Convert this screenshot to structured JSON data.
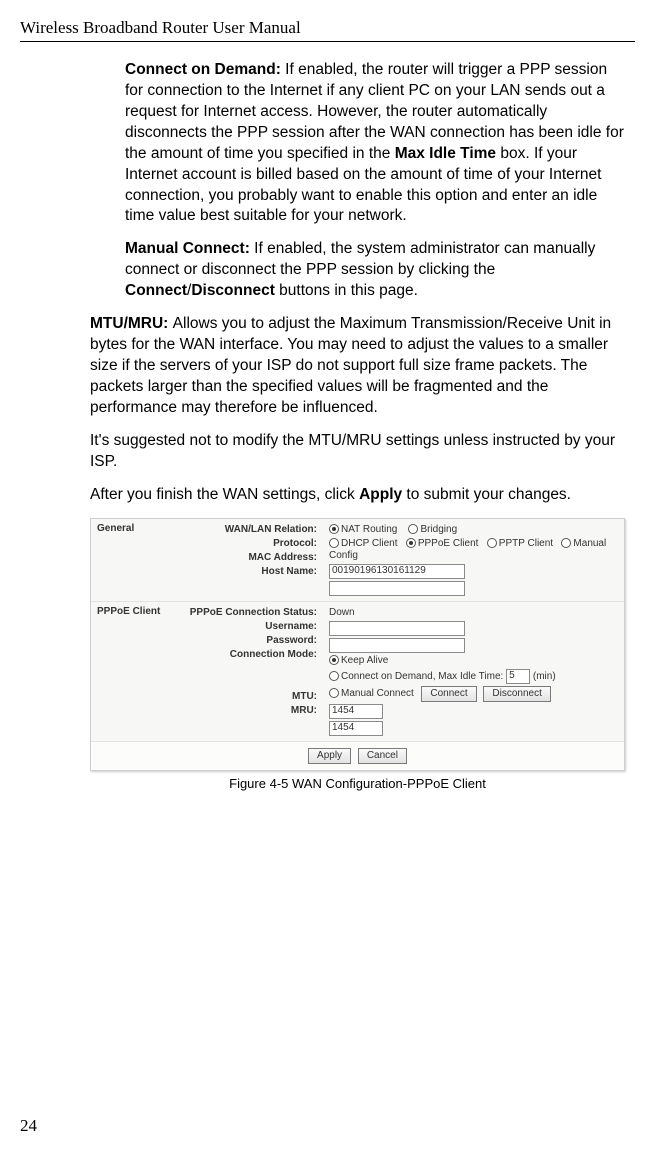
{
  "header": {
    "running_head": "Wireless Broadband Router User Manual"
  },
  "prose": {
    "para1": {
      "lead": "Connect on Demand: ",
      "text_a": "If enabled, the router will trigger a PPP session for connection to the Internet if any client PC on your LAN sends out a request for Internet access. However, the router automatically disconnects the PPP session after the WAN connection has been idle for the amount of time you specified in the ",
      "bold_mid": "Max Idle Time",
      "text_b": " box. If your Internet account is billed based on the amount of time of your Internet connection, you probably want to enable this option and enter an idle time value best suitable for your network."
    },
    "para2": {
      "lead": "Manual Connect: ",
      "text_a": "If enabled, the system administrator can manually connect or disconnect the PPP session by clicking the ",
      "bold_mid": "Connect",
      "slash": "/",
      "bold_mid2": "Disconnect",
      "text_b": " buttons in this page."
    },
    "para3": {
      "lead": "MTU/MRU: ",
      "text": "Allows you to adjust the Maximum Transmission/Receive Unit in bytes for the WAN interface. You may need to adjust the values to a smaller size if the servers of your ISP do not support full size frame packets. The packets larger than the specified values will be fragmented and the performance may therefore be influenced."
    },
    "para4": "It's suggested not to modify the MTU/MRU settings unless instructed by your ISP.",
    "para5_a": "After you finish the WAN settings, click ",
    "para5_bold": "Apply",
    "para5_b": " to submit your changes."
  },
  "figure": {
    "general": {
      "section": "General",
      "labels": {
        "relation": "WAN/LAN Relation:",
        "protocol": "Protocol:",
        "mac": "MAC Address:",
        "host": "Host Name:"
      },
      "options": {
        "nat": "NAT Routing",
        "bridging": "Bridging",
        "dhcp": "DHCP Client",
        "pppoe": "PPPoE Client",
        "pptp": "PPTP Client",
        "manual": "Manual Config"
      },
      "mac_value": "00190196130161129",
      "host_value": ""
    },
    "pppoe": {
      "section": "PPPoE Client",
      "labels": {
        "status": "PPPoE Connection Status:",
        "user": "Username:",
        "pass": "Password:",
        "mode": "Connection Mode:",
        "mtu": "MTU:",
        "mru": "MRU:"
      },
      "status_value": "Down",
      "user_value": "",
      "pass_value": "",
      "modes": {
        "keep": "Keep Alive",
        "cod": "Connect on Demand, Max Idle Time:",
        "cod_unit": "(min)",
        "manual": "Manual Connect"
      },
      "max_idle_value": "5",
      "buttons": {
        "connect": "Connect",
        "disconnect": "Disconnect"
      },
      "mtu_value": "1454",
      "mru_value": "1454"
    },
    "footer": {
      "apply": "Apply",
      "cancel": "Cancel"
    },
    "caption": "Figure 4-5    WAN Configuration-PPPoE Client"
  },
  "page_number": "24"
}
